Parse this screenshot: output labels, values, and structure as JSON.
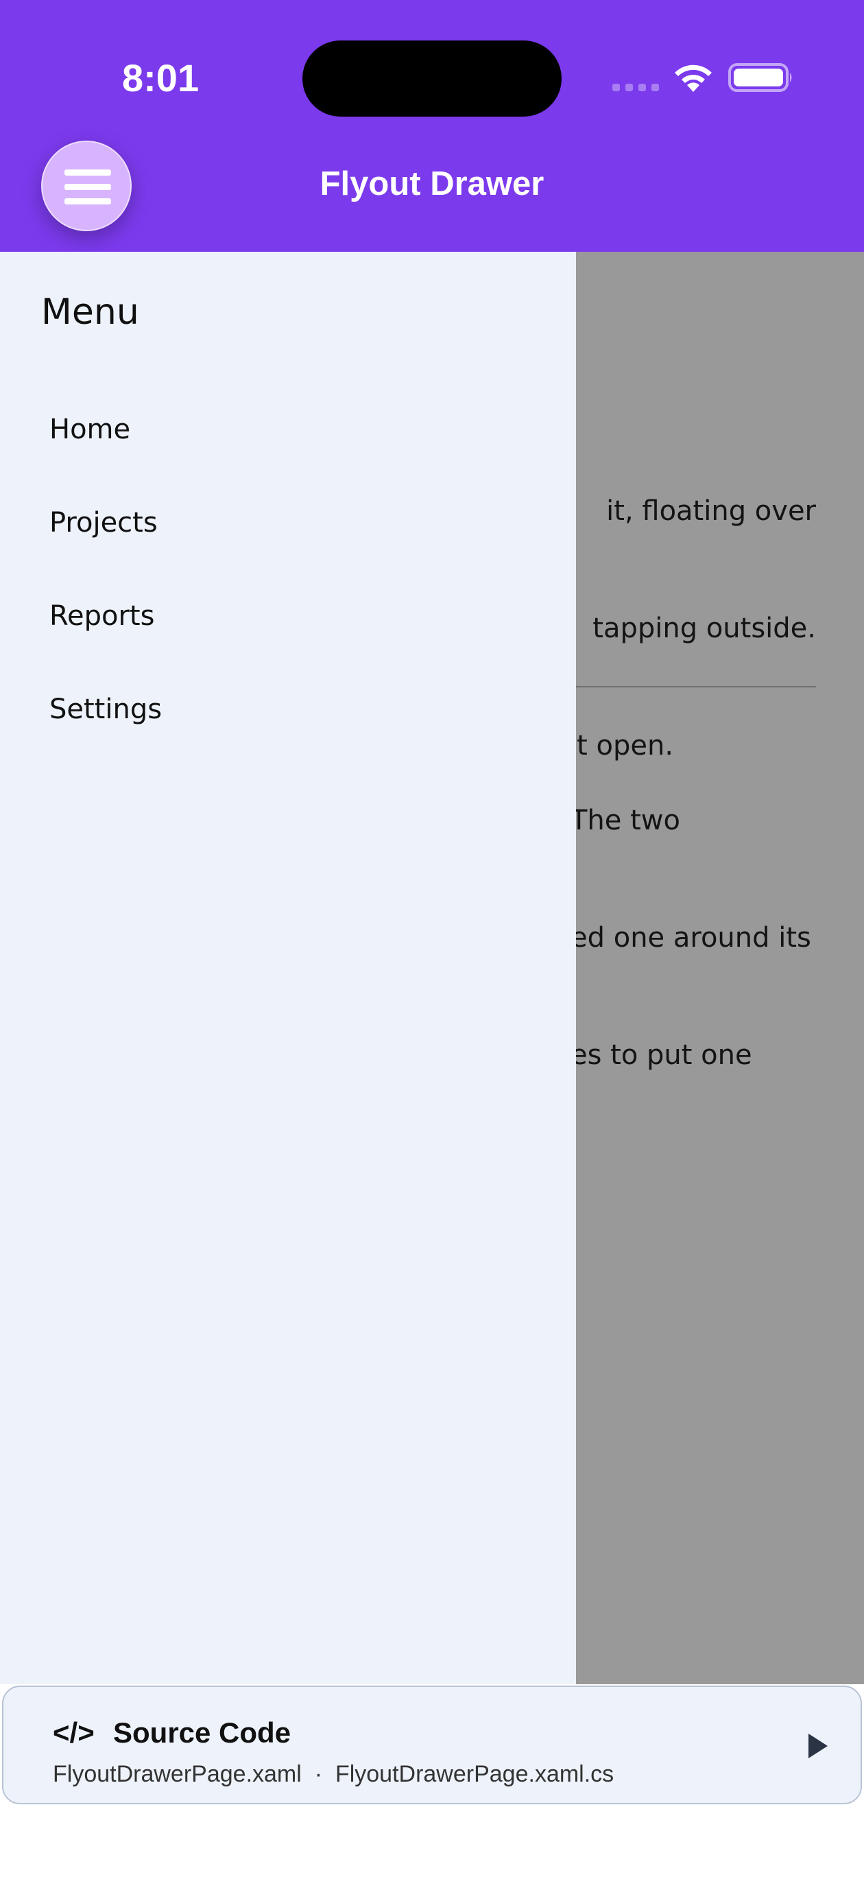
{
  "status_bar": {
    "time": "8:01"
  },
  "header": {
    "title": "Flyout Drawer",
    "menu_icon": "hamburger-icon",
    "background": "#7c3aed"
  },
  "content": {
    "paragraph1_lines": [
      "it, floating over",
      "tapping outside.",
      "it open."
    ],
    "paragraph2_lines": [
      "The two",
      "ed one around its",
      "es to put one"
    ]
  },
  "drawer": {
    "title": "Menu",
    "items": [
      {
        "label": "Home"
      },
      {
        "label": "Projects"
      },
      {
        "label": "Reports"
      },
      {
        "label": "Settings"
      }
    ],
    "background": "#eef3fb"
  },
  "source_card": {
    "code_icon": "</>",
    "title": "Source Code",
    "file1": "FlyoutDrawerPage.xaml",
    "separator": "·",
    "file2": "FlyoutDrawerPage.xaml.cs",
    "play_icon": "play-triangle-icon"
  }
}
